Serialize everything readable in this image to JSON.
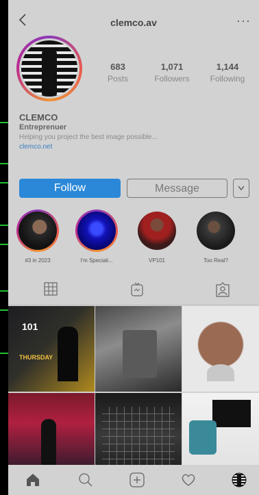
{
  "header": {
    "username": "clemco.av",
    "back_icon": "chevron-left-icon",
    "more_label": "···"
  },
  "profile": {
    "stats": [
      {
        "value": "683",
        "label": "Posts"
      },
      {
        "value": "1,071",
        "label": "Followers"
      },
      {
        "value": "1,144",
        "label": "Following"
      }
    ],
    "name": "CLEMCO",
    "category": "Entreprenuer",
    "bio": "Helping you project the best image possible...",
    "website": "clemco.net"
  },
  "actions": {
    "follow_label": "Follow",
    "message_label": "Message",
    "dropdown_glyph": "⌄"
  },
  "stories": [
    {
      "label": "#3 in 2023"
    },
    {
      "label": "I'm Speciali..."
    },
    {
      "label": "VP101"
    },
    {
      "label": "Too Real?"
    }
  ],
  "posts": {
    "tile1_text": {
      "line1": "101",
      "line2": "THURSDAY"
    }
  },
  "colors": {
    "accent": "#2b88d8",
    "background": "#d2d2d2",
    "link": "#3b7fc4"
  }
}
